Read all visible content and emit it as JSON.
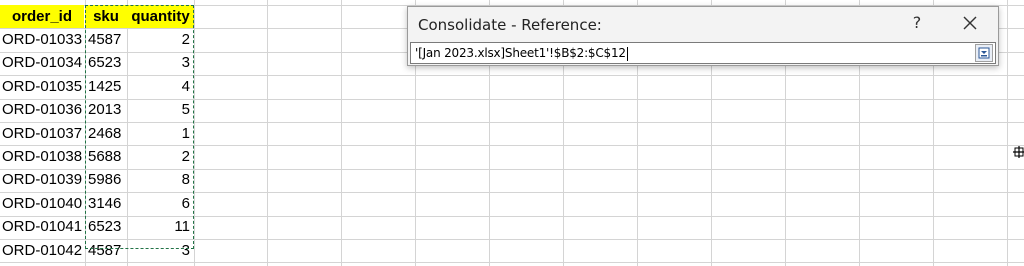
{
  "dialog": {
    "title": "Consolidate - Reference:",
    "help_label": "?",
    "reference_value": "'[Jan 2023.xlsx]Sheet1'!$B$2:$C$12",
    "close_icon": "close-icon",
    "collapse_icon": "collapse-dialog-icon"
  },
  "sheet": {
    "headers": [
      "order_id",
      "sku",
      "quantity"
    ],
    "rows": [
      {
        "order_id": "ORD-01033",
        "sku": "4587",
        "quantity": "2"
      },
      {
        "order_id": "ORD-01034",
        "sku": "6523",
        "quantity": "3"
      },
      {
        "order_id": "ORD-01035",
        "sku": "1425",
        "quantity": "4"
      },
      {
        "order_id": "ORD-01036",
        "sku": "2013",
        "quantity": "5"
      },
      {
        "order_id": "ORD-01037",
        "sku": "2468",
        "quantity": "1"
      },
      {
        "order_id": "ORD-01038",
        "sku": "5688",
        "quantity": "2"
      },
      {
        "order_id": "ORD-01039",
        "sku": "5986",
        "quantity": "8"
      },
      {
        "order_id": "ORD-01040",
        "sku": "3146",
        "quantity": "6"
      },
      {
        "order_id": "ORD-01041",
        "sku": "6523",
        "quantity": "11"
      },
      {
        "order_id": "ORD-01042",
        "sku": "4587",
        "quantity": "3"
      }
    ]
  },
  "colors": {
    "header_fill": "#ffff00",
    "selection_marquee": "#217346",
    "gridline": "#d4d4d4"
  }
}
